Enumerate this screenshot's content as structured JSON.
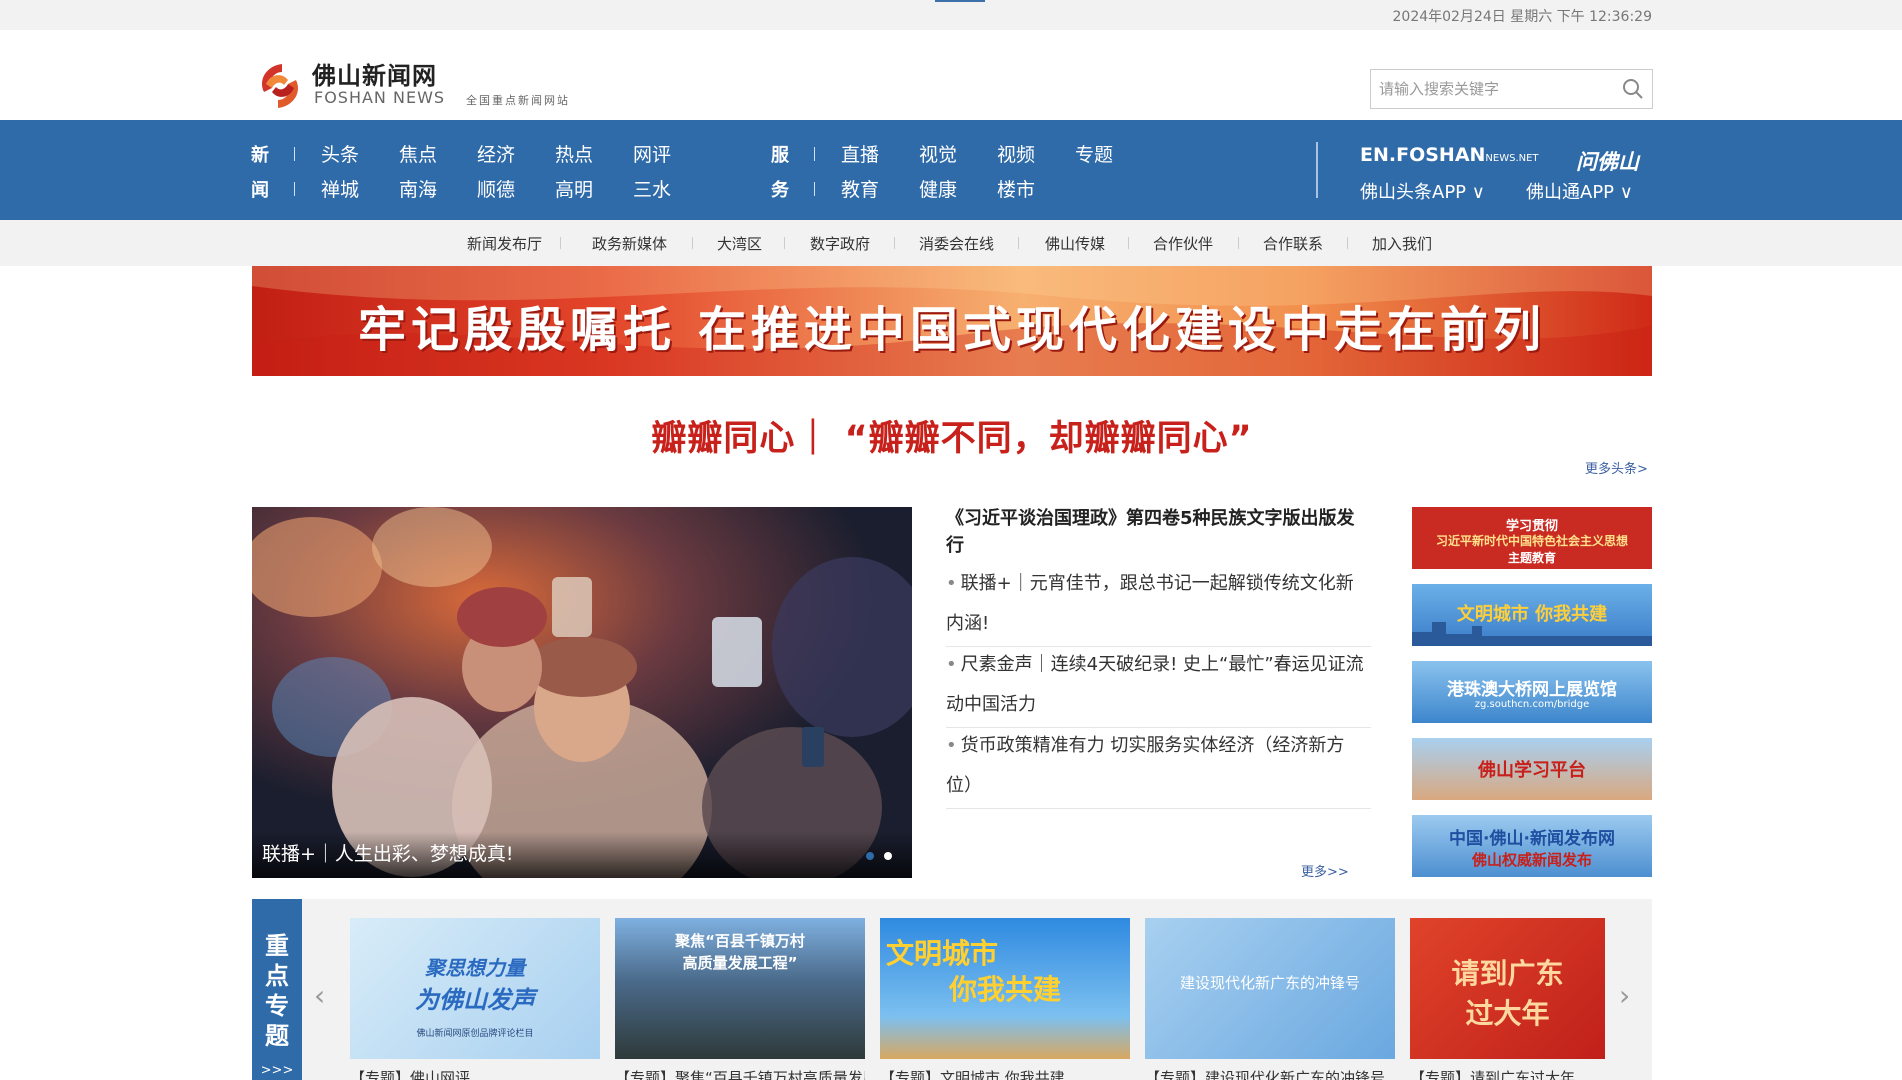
{
  "topbar": {
    "datetime": "2024年02月24日 星期六 下午 12:36:29"
  },
  "logo": {
    "name_cn": "佛山新闻网",
    "name_en": "FOSHAN NEWS",
    "tagline": "全国重点新闻网站"
  },
  "search": {
    "placeholder": "请输入搜索关键字"
  },
  "nav": {
    "group1_label_top": "新",
    "group1_label_bottom": "闻",
    "group1_row1": [
      "头条",
      "焦点",
      "经济",
      "热点",
      "网评"
    ],
    "group1_row2": [
      "禅城",
      "南海",
      "顺德",
      "高明",
      "三水"
    ],
    "group2_label_top": "服",
    "group2_label_bottom": "务",
    "group2_row1": [
      "直播",
      "视觉",
      "视频",
      "专题"
    ],
    "group2_row2": [
      "教育",
      "健康",
      "楼市"
    ],
    "en_site": "EN.FOSHAN",
    "en_site_sub": "NEWS.NET",
    "app1": "佛山头条APP ∨",
    "app2": "佛山通APP ∨",
    "wfs": "问佛山"
  },
  "subnav": [
    "新闻发布厅",
    "政务新媒体",
    "大湾区",
    "数字政府",
    "消委会在线",
    "佛山传媒",
    "合作伙伴",
    "合作联系",
    "加入我们"
  ],
  "banner": {
    "text": "牢记殷殷嘱托  在推进中国式现代化建设中走在前列"
  },
  "headline": {
    "text": "瓣瓣同心｜ “瓣瓣不同，却瓣瓣同心”",
    "more": "更多头条>"
  },
  "slider": {
    "caption": "联播+｜人生出彩、梦想成真!"
  },
  "news": {
    "top_title": "《习近平谈治国理政》第四卷5种民族文字版出版发行",
    "items": [
      "联播+｜元宵佳节，跟总书记一起解锁传统文化新内涵!",
      "尺素金声｜连续4天破纪录! 史上“最忙”春运见证流动中国活力",
      "货币政策精准有力 切实服务实体经济（经济新方位）"
    ],
    "more": "更多>>"
  },
  "right_banners": [
    {
      "line1": "学习贯彻",
      "line2": "习近平新时代中国特色社会主义思想",
      "line3": "主题教育"
    },
    {
      "line1": "文明城市 你我共建"
    },
    {
      "line1": "港珠澳大桥网上展览馆",
      "line2": "zg.southcn.com/bridge"
    },
    {
      "line1": "佛山学习平台"
    },
    {
      "line1": "中国·佛山·新闻发布网",
      "line2": "佛山权威新闻发布"
    }
  ],
  "topics": {
    "label": "重点专题",
    "more": ">>>",
    "cards": [
      {
        "img_text1": "聚思想力量",
        "img_text2": "为佛山发声",
        "img_text3": "佛山新闻网原创品牌评论栏目",
        "caption": "【专题】佛山网评"
      },
      {
        "img_text1": "聚焦“百县千镇万村",
        "img_text2": "高质量发展工程”",
        "caption": "【专题】聚焦“百县千镇万村高质量发展工程”"
      },
      {
        "img_text1": "文明城市",
        "img_text2": "你我共建",
        "caption": "【专题】文明城市 你我共建"
      },
      {
        "img_text1": "建设现代化新广东的冲锋号",
        "caption": "【专题】建设现代化新广东的冲锋号"
      },
      {
        "img_text1": "请到广东",
        "img_text2": "过大年",
        "caption": "【专题】请到广东过大年"
      }
    ]
  },
  "colors": {
    "nav_blue": "#2f6aa9",
    "headline_red": "#c8201a",
    "link_blue": "#3a5fa0"
  }
}
